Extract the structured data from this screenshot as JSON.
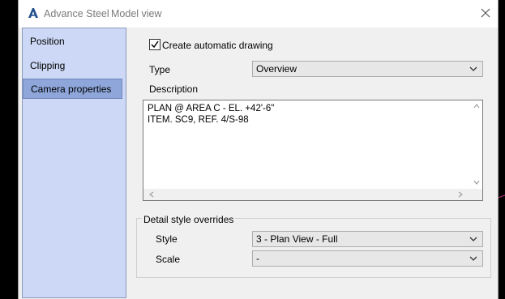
{
  "window": {
    "app_name": "Advance Steel",
    "title": "Model view"
  },
  "sidebar": {
    "items": [
      {
        "label": "Position",
        "selected": false
      },
      {
        "label": "Clipping",
        "selected": false
      },
      {
        "label": "Camera properties",
        "selected": true
      }
    ]
  },
  "form": {
    "auto_drawing": {
      "label": "Create automatic drawing",
      "checked": true
    },
    "type": {
      "label": "Type",
      "value": "Overview"
    },
    "description": {
      "label": "Description",
      "line1": "PLAN @ AREA C - EL. +42'-6\"",
      "line2": "ITEM. SC9, REF. 4/S-98"
    },
    "detail_style_overrides": {
      "title": "Detail style overrides",
      "style": {
        "label": "Style",
        "value": "3 - Plan View - Full"
      },
      "scale": {
        "label": "Scale",
        "value": "-"
      }
    }
  },
  "colors": {
    "sidebar_bg": "#ccd8f5",
    "sidebar_selected": "#8ea6da",
    "accent_line": "#c0307f"
  }
}
